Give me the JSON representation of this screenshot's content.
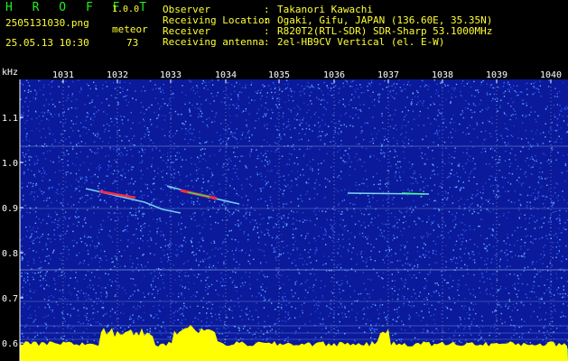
{
  "header": {
    "app_title": "H R O F F T",
    "version": "1.0.0",
    "filename": "2505131030.png",
    "datetime": "25.05.13 10:30",
    "meteor_label": "meteor",
    "meteor_count": "73",
    "info": [
      {
        "label": "Observer",
        "value": "Takanori Kawachi"
      },
      {
        "label": "Receiving Location",
        "value": "Ogaki, Gifu, JAPAN (136.60E, 35.35N)"
      },
      {
        "label": "Receiver",
        "value": "R820T2(RTL-SDR) SDR-Sharp 53.1000MHz"
      },
      {
        "label": "Receiving antenna",
        "value": "2el-HB9CV Vertical (el. E-W)"
      }
    ]
  },
  "chart_data": {
    "type": "heatmap",
    "ylabel": "kHz",
    "x_ticks": [
      "1031",
      "1032",
      "1033",
      "1034",
      "1035",
      "1036",
      "1037",
      "1038",
      "1039",
      "1040"
    ],
    "y_ticks": [
      "1.1",
      "1.0",
      "0.9",
      "0.8",
      "0.7",
      "0.6"
    ],
    "colors": {
      "background": "#0a1a9a",
      "noise": "#3a6aff",
      "baseline": "#ffff00",
      "echo_hot": "#ff2a40",
      "grid": "#cccccc"
    }
  }
}
